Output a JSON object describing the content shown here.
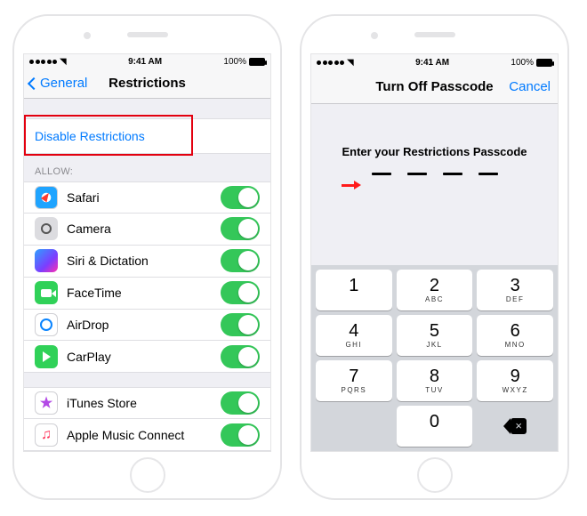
{
  "status": {
    "time": "9:41 AM",
    "battery": "100%"
  },
  "left": {
    "back_label": "General",
    "title": "Restrictions",
    "disable_label": "Disable Restrictions",
    "allow_header": "ALLOW:",
    "apps": [
      {
        "name": "Safari"
      },
      {
        "name": "Camera"
      },
      {
        "name": "Siri & Dictation"
      },
      {
        "name": "FaceTime"
      },
      {
        "name": "AirDrop"
      },
      {
        "name": "CarPlay"
      }
    ],
    "store_apps": [
      {
        "name": "iTunes Store"
      },
      {
        "name": "Apple Music Connect"
      }
    ]
  },
  "right": {
    "title": "Turn Off Passcode",
    "cancel": "Cancel",
    "prompt": "Enter your Restrictions Passcode",
    "keys": [
      {
        "d": "1",
        "l": ""
      },
      {
        "d": "2",
        "l": "ABC"
      },
      {
        "d": "3",
        "l": "DEF"
      },
      {
        "d": "4",
        "l": "GHI"
      },
      {
        "d": "5",
        "l": "JKL"
      },
      {
        "d": "6",
        "l": "MNO"
      },
      {
        "d": "7",
        "l": "PQRS"
      },
      {
        "d": "8",
        "l": "TUV"
      },
      {
        "d": "9",
        "l": "WXYZ"
      }
    ],
    "zero": "0"
  }
}
